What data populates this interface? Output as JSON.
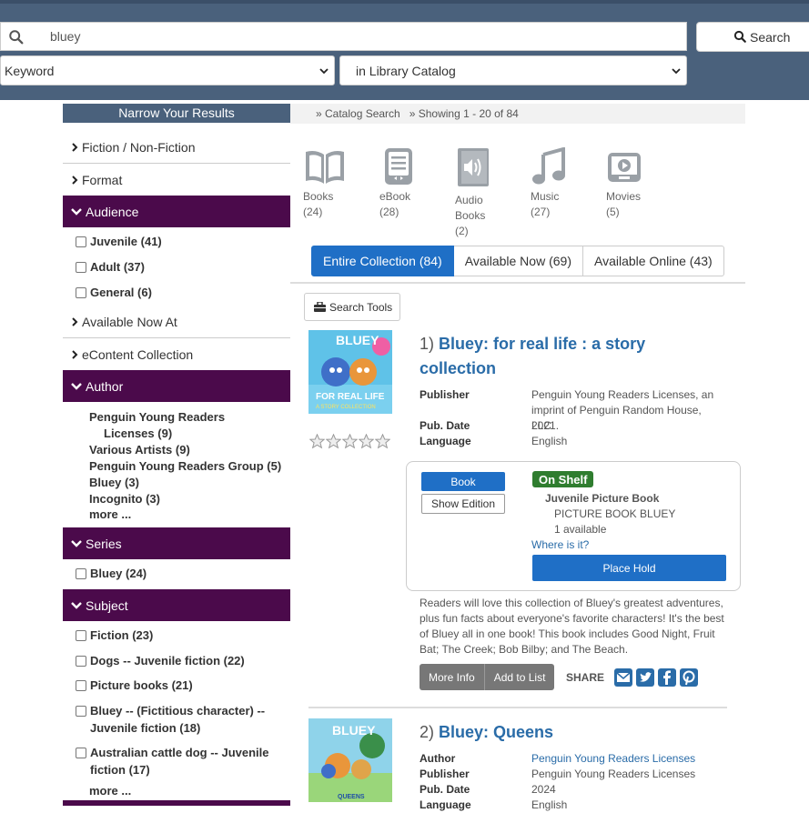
{
  "header": {
    "search_value": "bluey",
    "search_button": "Search",
    "search_type": "Keyword",
    "search_scope": "in Library Catalog"
  },
  "sidebar": {
    "title": "Narrow Your Results",
    "facet_fiction": "Fiction / Non-Fiction",
    "facet_format": "Format",
    "audience": {
      "label": "Audience",
      "items": [
        "Juvenile (41)",
        "Adult (37)",
        "General (6)"
      ]
    },
    "facet_available": "Available Now At",
    "facet_econtent": "eContent Collection",
    "author": {
      "label": "Author",
      "items": [
        "Penguin Young Readers",
        "Licenses (9)",
        "Various Artists (9)",
        "Penguin Young Readers Group (5)",
        "Bluey (3)",
        "Incognito (3)"
      ],
      "more": "more ..."
    },
    "series": {
      "label": "Series",
      "items": [
        "Bluey (24)"
      ]
    },
    "subject": {
      "label": "Subject",
      "items": [
        "Fiction (23)",
        "Dogs -- Juvenile fiction (22)",
        "Picture books (21)",
        "Bluey -- (Fictitious character) --",
        "Juvenile fiction (18)",
        "Australian cattle dog -- Juvenile",
        "fiction (17)"
      ],
      "more": "more ..."
    }
  },
  "breadcrumb": [
    "» Catalog Search",
    "» Showing 1 - 20 of 84"
  ],
  "formats": [
    {
      "label": "Books",
      "count": "(24)"
    },
    {
      "label": "eBook",
      "count": "(28)"
    },
    {
      "label": "Audio",
      "label2": "Books",
      "count": "(2)"
    },
    {
      "label": "Music",
      "count": "(27)"
    },
    {
      "label": "Movies",
      "count": "(5)"
    }
  ],
  "tabs": [
    "Entire Collection (84)",
    "Available Now (69)",
    "Available Online (43)"
  ],
  "search_tools": "Search Tools",
  "results": [
    {
      "num": "1)",
      "title_line1": "Bluey: for real life : a story",
      "title_line2": "collection",
      "cover_title": "BLUEY",
      "cover_sub": "FOR REAL LIFE",
      "cover_sub2": "A STORY COLLECTION",
      "meta": {
        "publisher_label": "Publisher",
        "publisher_1": "Penguin Young Readers Licenses, an",
        "publisher_2": "imprint of Penguin Random House, LLC",
        "pubdate_label": "Pub. Date",
        "pubdate": "2021.",
        "language_label": "Language",
        "language": "English"
      },
      "hold": {
        "book_btn": "Book",
        "show_edition": "Show Edition",
        "status": "On Shelf",
        "location": "Juvenile Picture Book",
        "call_number": "PICTURE BOOK BLUEY",
        "available": "1 available",
        "where": "Where is it?",
        "place_hold": "Place Hold"
      },
      "description": "Readers will love this collection of Bluey's greatest adventures, plus fun facts about everyone's favorite characters! It's the best of Bluey all in one book! This book includes Good Night, Fruit Bat; The Creek; Bob Bilby; and The Beach.",
      "more_info": "More Info",
      "add_to_list": "Add to List",
      "share": "SHARE"
    },
    {
      "num": "2)",
      "title_line1": "Bluey: Queens",
      "cover_title": "BLUEY",
      "cover_sub": "QUEENS",
      "meta": {
        "author_label": "Author",
        "author": "Penguin Young Readers Licenses",
        "publisher_label": "Publisher",
        "publisher": "Penguin Young Readers Licenses",
        "pubdate_label": "Pub. Date",
        "pubdate": "2024",
        "language_label": "Language",
        "language": "English"
      }
    }
  ],
  "colors": {
    "header": "#4a617c",
    "facet_header": "#4b0a4b",
    "primary": "#1f6fc6",
    "link": "#2a6ca8",
    "on_shelf": "#2f7d2f"
  }
}
